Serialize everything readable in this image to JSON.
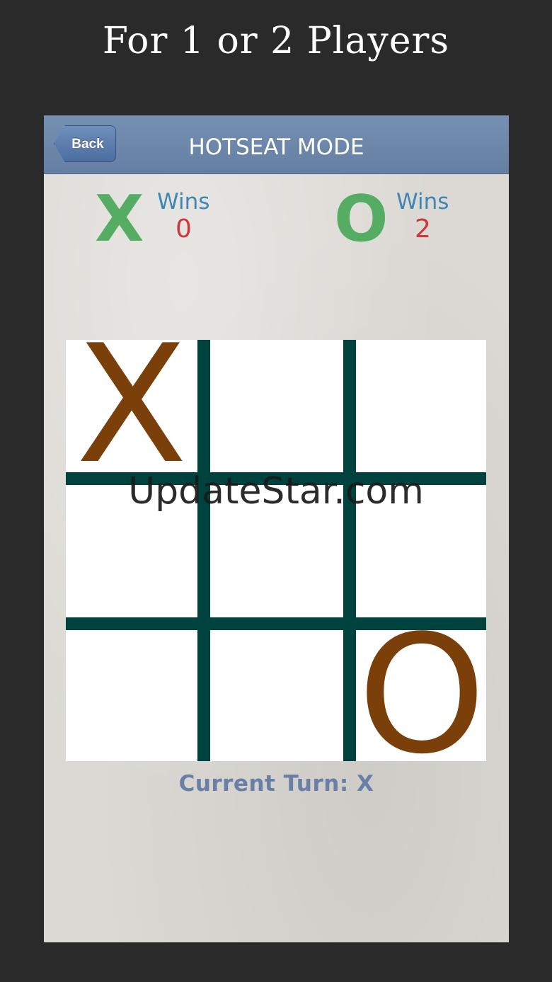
{
  "headline": "For 1 or 2 Players",
  "navbar": {
    "back_label": "Back",
    "title": "HOTSEAT MODE"
  },
  "scores": {
    "x": {
      "mark": "X",
      "label": "Wins",
      "count": "0"
    },
    "o": {
      "mark": "O",
      "label": "Wins",
      "count": "2"
    }
  },
  "board": {
    "cells": [
      "X",
      "",
      "",
      "",
      "",
      "",
      "",
      "",
      "O"
    ]
  },
  "status": {
    "current_turn": "Current Turn: X"
  },
  "watermark": "UpdateStar.com",
  "colors": {
    "navbar": "#6a85a9",
    "score_mark": "#55ad63",
    "wins_label": "#3f86b3",
    "wins_count": "#d0363a",
    "grid": "#00423d",
    "piece": "#7b3f0a",
    "turn_text": "#6a7fa6"
  }
}
